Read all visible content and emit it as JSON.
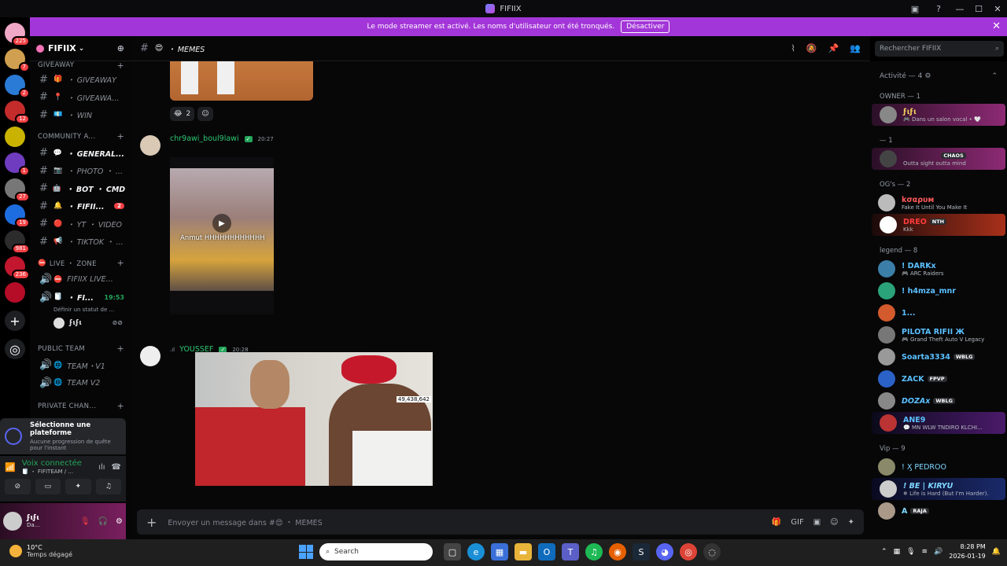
{
  "window": {
    "title": "FIFIIX"
  },
  "titlebar": {
    "help_icon": "?",
    "minimize": "—",
    "maximize": "☐",
    "close": "✕"
  },
  "banner": {
    "text": "Le mode streamer est activé. Les noms d'utilisateur ont été tronqués.",
    "button": "Désactiver",
    "close": "✕"
  },
  "guilds": [
    {
      "color": "#f1a7c6",
      "badge": "225"
    },
    {
      "color": "#d0a050",
      "badge": "7"
    },
    {
      "color": "#2a7bd6",
      "badge": "2"
    },
    {
      "color": "#c42b2b",
      "badge": "12"
    },
    {
      "color": "#c9b300",
      "badge": ""
    },
    {
      "color": "#6f3cc0",
      "badge": "1"
    },
    {
      "color": "#777777",
      "badge": "27"
    },
    {
      "color": "#1e6de0",
      "badge": "19"
    },
    {
      "color": "#2c2c2c",
      "badge": "981"
    },
    {
      "color": "#c2172f",
      "badge": "236"
    },
    {
      "color": "#b50d27",
      "badge": ""
    }
  ],
  "guild_add": "+",
  "server": {
    "name": "FIFIIX",
    "chevron": "⌄",
    "add_user_icon": "⊕"
  },
  "categories": {
    "giveaway": "GIVEAWAY",
    "community": "COMMUNITY A...",
    "live_zone": "LIVE ・ ZONE",
    "public_team": "PUBLIC TEAM",
    "private_chan": "PRIVATE CHAN..."
  },
  "channels": {
    "giveaway1": {
      "emoji": "🎁",
      "label": "・ GIVEAWAY"
    },
    "giveaway2": {
      "emoji": "📍",
      "label": "・ GIVEAWA..."
    },
    "win": {
      "emoji": "💶",
      "label": "・ WIN"
    },
    "general": {
      "emoji": "💬",
      "label": "・ GENERAL..."
    },
    "photo": {
      "emoji": "📷",
      "label": "・ PHOTO ・ ..."
    },
    "bot": {
      "emoji": "🤖",
      "label": "・ BOT ・ CMD"
    },
    "fifii": {
      "emoji": "🔔",
      "label": "・ FIFII...",
      "badge": "2"
    },
    "yt": {
      "emoji": "🔴",
      "label": "・ YT ・ VIDEO"
    },
    "tiktok": {
      "emoji": "📢",
      "label": "・ TIKTOK ・ ..."
    },
    "fifiix_live": {
      "emoji": "⛔",
      "label": "FIFIIX LIVE..."
    },
    "voice_fi": {
      "emoji": "🧻",
      "label": "・ FI...",
      "time": "19:53"
    },
    "team_v1": {
      "emoji": "🌐",
      "label": "TEAM・V1"
    },
    "team_v2": {
      "emoji": "🌐",
      "label": "TEAM V2"
    }
  },
  "voice_sub": "Définir un statut de ...",
  "voice_user": "ϝιϝι",
  "platform": {
    "title": "Sélectionne une plateforme",
    "sub": "Aucune progression de quête pour l'instant"
  },
  "voice": {
    "title": "Voix connectée",
    "sub": "🧻 ・ FIFITEAM / ..."
  },
  "user_panel": {
    "name": "ϝιϝι",
    "status": "Da..."
  },
  "header": {
    "emoji": "😍",
    "channel": "・ MEMES"
  },
  "search": {
    "placeholder": "Rechercher FIFIIX",
    "icon": "⌕"
  },
  "reactions": [
    {
      "emoji": "😂",
      "count": "2"
    },
    {
      "emoji": "☺",
      "count": ""
    }
  ],
  "messages": [
    {
      "author": "chr9awi_boul9lawi",
      "verified": "✓",
      "time": "20:27",
      "caption": "Anmut HHHHHHHHHHHH"
    },
    {
      "author": "YOUSSEF",
      "verified": "✓",
      "time": "20:28",
      "counter": "49,438,642"
    }
  ],
  "composer": {
    "placeholder": "Envoyer un message dans #😍 ・ MEMES",
    "plus": "+"
  },
  "members": {
    "activity_label": "Activité — 4",
    "groups": {
      "owner": "OWNER — 1",
      "one": "— 1",
      "ogs": "OG's — 2",
      "legend": "legend — 8",
      "vip": "Vip — 9"
    },
    "list": [
      {
        "name": "ϝιϝι",
        "sub": "🎮 Dans un salon vocal • 🤍",
        "color": "#f4d35e",
        "tag": ""
      },
      {
        "name": "CHAOS",
        "sub": "Outta sight outta mind",
        "color": "#ffffff",
        "tag": ""
      },
      {
        "name": "kσαρυм",
        "sub": "Fake It Until You Make It",
        "color": "#ff5a5a",
        "tag": ""
      },
      {
        "name": "DREO",
        "sub": "Kkk",
        "color": "#ff3b3b",
        "tag": "NTH"
      },
      {
        "name": "! DARKx",
        "sub": "🎮 ARC Raiders",
        "color": "#5bc0ff",
        "tag": ""
      },
      {
        "name": "! h4mza_mnr",
        "sub": "",
        "color": "#5bc0ff",
        "tag": ""
      },
      {
        "name": "1...",
        "sub": "",
        "color": "#5bc0ff",
        "tag": ""
      },
      {
        "name": "PILOTA RIFII Ж",
        "sub": "🎮 Grand Theft Auto V Legacy",
        "color": "#5bc0ff",
        "tag": ""
      },
      {
        "name": "Soarta3334",
        "sub": "",
        "color": "#5bc0ff",
        "tag": "WBLG"
      },
      {
        "name": "ZACK",
        "sub": "",
        "color": "#5bc0ff",
        "tag": "FPVP"
      },
      {
        "name": "DOZAx",
        "sub": "",
        "color": "#5bc0ff",
        "tag": "WBLG"
      },
      {
        "name": "ANE9",
        "sub": "💬 MN WLW TNDIRO KLCHI...",
        "color": "#5bc0ff",
        "tag": ""
      },
      {
        "name": "! Ӽ PEDROO",
        "sub": "",
        "color": "#7fd7ff",
        "tag": ""
      },
      {
        "name": "! BE | KIRYU",
        "sub": "❄ Life is Hard (But I'm Harder).",
        "color": "#7fd7ff",
        "tag": ""
      },
      {
        "name": "A",
        "sub": "",
        "color": "#7fd7ff",
        "tag": "RAJA"
      }
    ]
  },
  "taskbar": {
    "temp": "10°C",
    "weather": "Temps dégagé",
    "search": "Search",
    "time": "8:28 PM",
    "date": "2026-01-19"
  }
}
